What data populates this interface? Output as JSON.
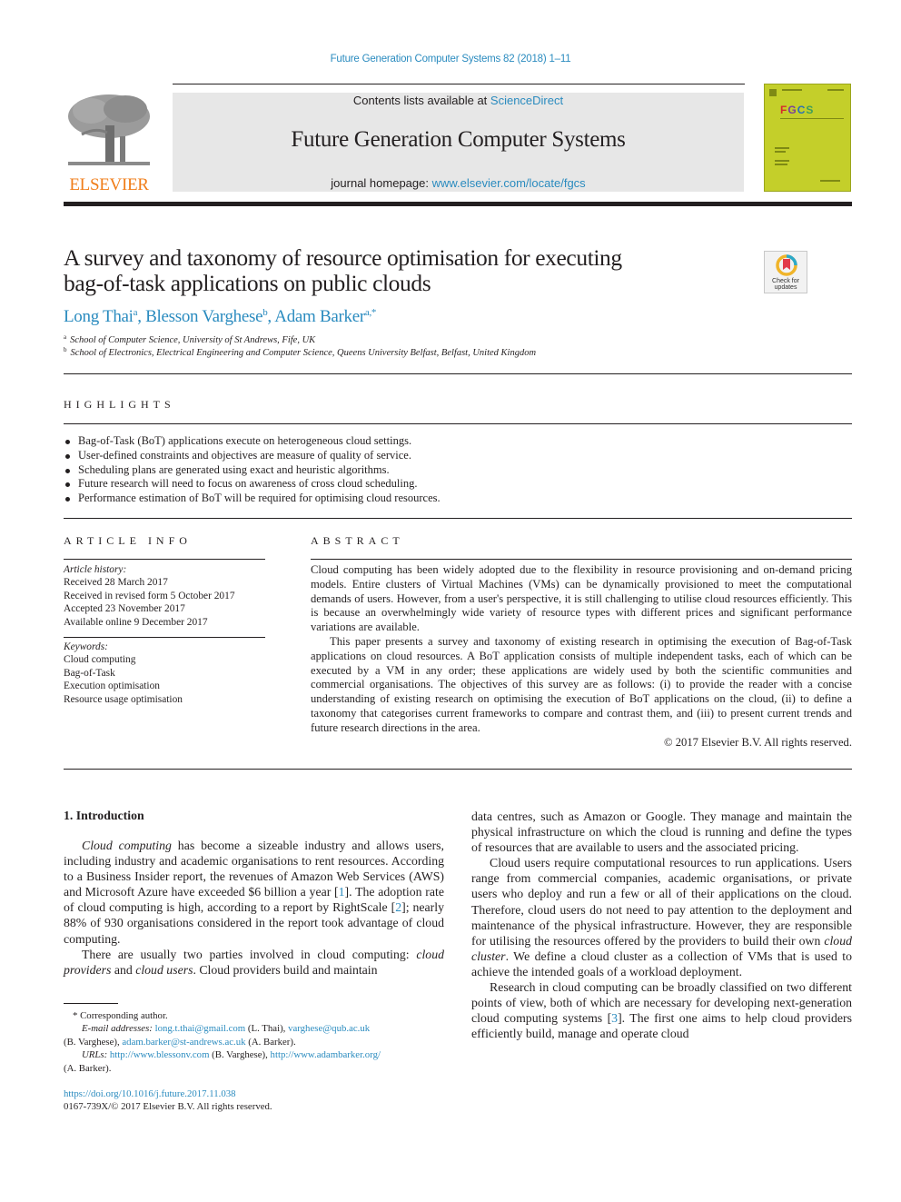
{
  "running_head": "Future Generation Computer Systems 82 (2018) 1–11",
  "masthead": {
    "publisher_logo_text": "ELSEVIER",
    "contents_prefix": "Contents lists available at ",
    "contents_link": "ScienceDirect",
    "journal_title": "Future Generation Computer Systems",
    "homepage_prefix": "journal homepage: ",
    "homepage_link": "www.elsevier.com/locate/fgcs",
    "cover_label": "FGCS"
  },
  "title": {
    "line1": "A survey and taxonomy of resource optimisation for executing",
    "line2": "bag-of-task applications on public clouds",
    "check_updates_line1": "Check for",
    "check_updates_line2": "updates"
  },
  "authors": [
    {
      "name": "Long Thai",
      "sup": "a",
      "sep": ", "
    },
    {
      "name": "Blesson Varghese",
      "sup": "b",
      "sep": ", "
    },
    {
      "name": "Adam Barker",
      "sup": "a,*",
      "sep": ""
    }
  ],
  "affiliations": [
    {
      "mark": "a",
      "text": "School of Computer Science, University of St Andrews, Fife, UK"
    },
    {
      "mark": "b",
      "text": "School of Electronics, Electrical Engineering and Computer Science, Queens University Belfast, Belfast, United Kingdom"
    }
  ],
  "highlights": {
    "heading": "HIGHLIGHTS",
    "items": [
      "Bag-of-Task (BoT) applications execute on heterogeneous cloud settings.",
      "User-defined constraints and objectives are measure of quality of service.",
      "Scheduling plans are generated using exact and heuristic algorithms.",
      "Future research will need to focus on awareness of cross cloud scheduling.",
      "Performance estimation of BoT will be required for optimising cloud resources."
    ]
  },
  "article_info": {
    "heading": "ARTICLE INFO",
    "history_label": "Article history:",
    "history": [
      "Received 28 March 2017",
      "Received in revised form 5 October 2017",
      "Accepted 23 November 2017",
      "Available online 9 December 2017"
    ],
    "keywords_label": "Keywords:",
    "keywords": [
      "Cloud computing",
      "Bag-of-Task",
      "Execution optimisation",
      "Resource usage optimisation"
    ]
  },
  "abstract": {
    "heading": "ABSTRACT",
    "p1": "Cloud computing has been widely adopted due to the flexibility in resource provisioning and on-demand pricing models. Entire clusters of Virtual Machines (VMs) can be dynamically provisioned to meet the computational demands of users. However, from a user's perspective, it is still challenging to utilise cloud resources efficiently. This is because an overwhelmingly wide variety of resource types with different prices and significant performance variations are available.",
    "p2": "This paper presents a survey and taxonomy of existing research in optimising the execution of Bag-of-Task applications on cloud resources. A BoT application consists of multiple independent tasks, each of which can be executed by a VM in any order; these applications are widely used by both the scientific communities and commercial organisations. The objectives of this survey are as follows: (i) to provide the reader with a concise understanding of existing research on optimising the execution of BoT applications on the cloud, (ii) to define a taxonomy that categorises current frameworks to compare and contrast them, and (iii) to present current trends and future research directions in the area.",
    "copyright": "© 2017 Elsevier B.V. All rights reserved."
  },
  "intro": {
    "heading": "1.  Introduction",
    "p1_italic": "Cloud computing",
    "p1_a": " has become a sizeable industry and allows users, including industry and academic organisations to rent resources. According to a Business Insider report, the revenues of Amazon Web Services (AWS) and Microsoft Azure have exceeded $6 billion a year [",
    "ref1": "1",
    "p1_b": "]. The adoption rate of cloud computing is high, according to a report by RightScale [",
    "ref2": "2",
    "p1_c": "]; nearly 88% of 930 organisations considered in the report took advantage of cloud computing.",
    "p2_a": "There are usually two parties involved in cloud computing: ",
    "p2_i1": "cloud providers",
    "p2_b": " and ",
    "p2_i2": "cloud users",
    "p2_c": ". Cloud providers build and maintain",
    "col2_p1": "data centres, such as Amazon or Google. They manage and maintain the physical infrastructure on which the cloud is running and define the types of resources that are available to users and the associated pricing.",
    "col2_p2_a": "Cloud users require computational resources to run applications. Users range from commercial companies, academic organisations, or private users who deploy and run a few or all of their applications on the cloud. Therefore, cloud users do not need to pay attention to the deployment and maintenance of the physical infrastructure. However, they are responsible for utilising the resources offered by the providers to build their own ",
    "col2_p2_i": "cloud cluster",
    "col2_p2_b": ". We define a cloud cluster as a collection of VMs that is used to achieve the intended goals of a workload deployment.",
    "col2_p3_a": "Research in cloud computing can be broadly classified on two different points of view, both of which are necessary for developing next-generation cloud computing systems [",
    "ref3": "3",
    "col2_p3_b": "]. The first one aims to help cloud providers efficiently build, manage and operate cloud"
  },
  "footnotes": {
    "corresponding": "* Corresponding author.",
    "email_label": "E-mail addresses:",
    "email1": "long.t.thai@gmail.com",
    "email1_who": " (L. Thai), ",
    "email2": "varghese@qub.ac.uk",
    "email2_who": "(B. Varghese), ",
    "email3": "adam.barker@st-andrews.ac.uk",
    "email3_who": " (A. Barker).",
    "urls_label": "URLs:",
    "url1": "http://www.blessonv.com",
    "url1_who": " (B. Varghese), ",
    "url2": "http://www.adambarker.org/",
    "url2_who": "(A. Barker).",
    "doi": "https://doi.org/10.1016/j.future.2017.11.038",
    "issn": "0167-739X/© 2017 Elsevier B.V. All rights reserved."
  }
}
